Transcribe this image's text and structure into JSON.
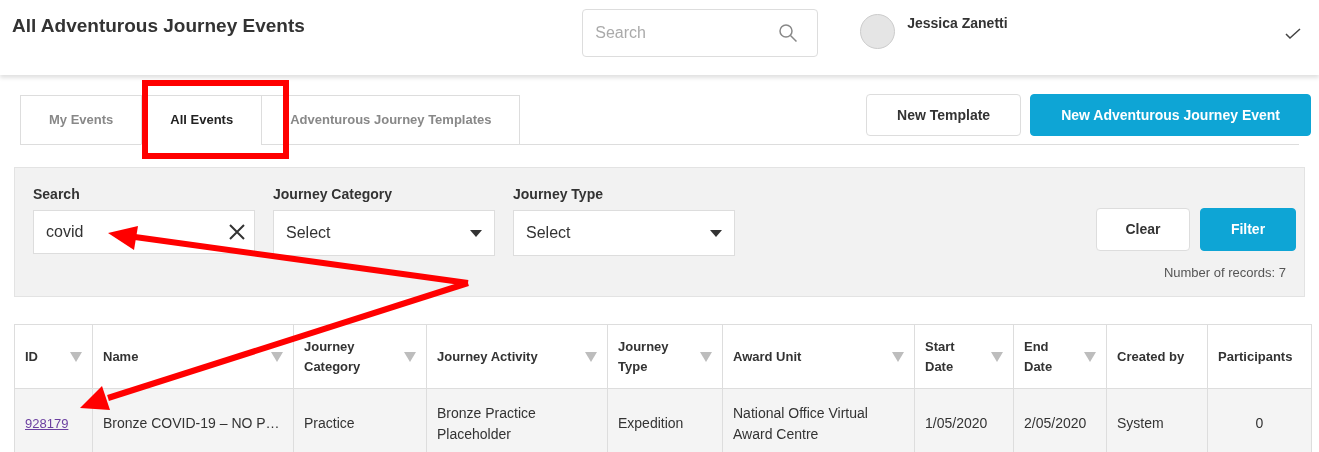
{
  "page_title": "All Adventurous Journey Events",
  "header": {
    "search": {
      "placeholder": "Search"
    },
    "user": {
      "name": "Jessica Zanetti"
    }
  },
  "tabs": [
    {
      "label": "My Events",
      "selected": false
    },
    {
      "label": "All Events",
      "selected": true
    },
    {
      "label": "Adventurous Journey Templates",
      "selected": false
    }
  ],
  "actions": [
    {
      "label": "New Template",
      "kind": "secondary"
    },
    {
      "label": "New Adventurous Journey Event",
      "kind": "primary"
    }
  ],
  "filters": {
    "search": {
      "label": "Search",
      "value": "covid"
    },
    "selects": [
      {
        "label": "Journey Category",
        "value": "Select"
      },
      {
        "label": "Journey Type",
        "value": "Select"
      }
    ],
    "buttons": [
      {
        "label": "Clear",
        "kind": "secondary"
      },
      {
        "label": "Filter",
        "kind": "primary"
      }
    ],
    "record_count": "Number of records: 7"
  },
  "table": {
    "columns": [
      {
        "label": "ID",
        "sortable": true
      },
      {
        "label": "Name",
        "sortable": true
      },
      {
        "label": "Journey Category",
        "sortable": true
      },
      {
        "label": "Journey Activity",
        "sortable": true
      },
      {
        "label": "Journey Type",
        "sortable": true
      },
      {
        "label": "Award Unit",
        "sortable": true
      },
      {
        "label": "Start Date",
        "sortable": true
      },
      {
        "label": "End Date",
        "sortable": true
      },
      {
        "label": "Created by",
        "sortable": false
      },
      {
        "label": "Participants",
        "sortable": false
      }
    ],
    "rows": [
      [
        "928179",
        "Bronze COVID-19 – NO P…",
        "Practice",
        "Bronze Practice Placeholder",
        "Expedition",
        "National Office Virtual Award Centre",
        "1/05/2020",
        "2/05/2020",
        "System",
        "0"
      ]
    ]
  }
}
